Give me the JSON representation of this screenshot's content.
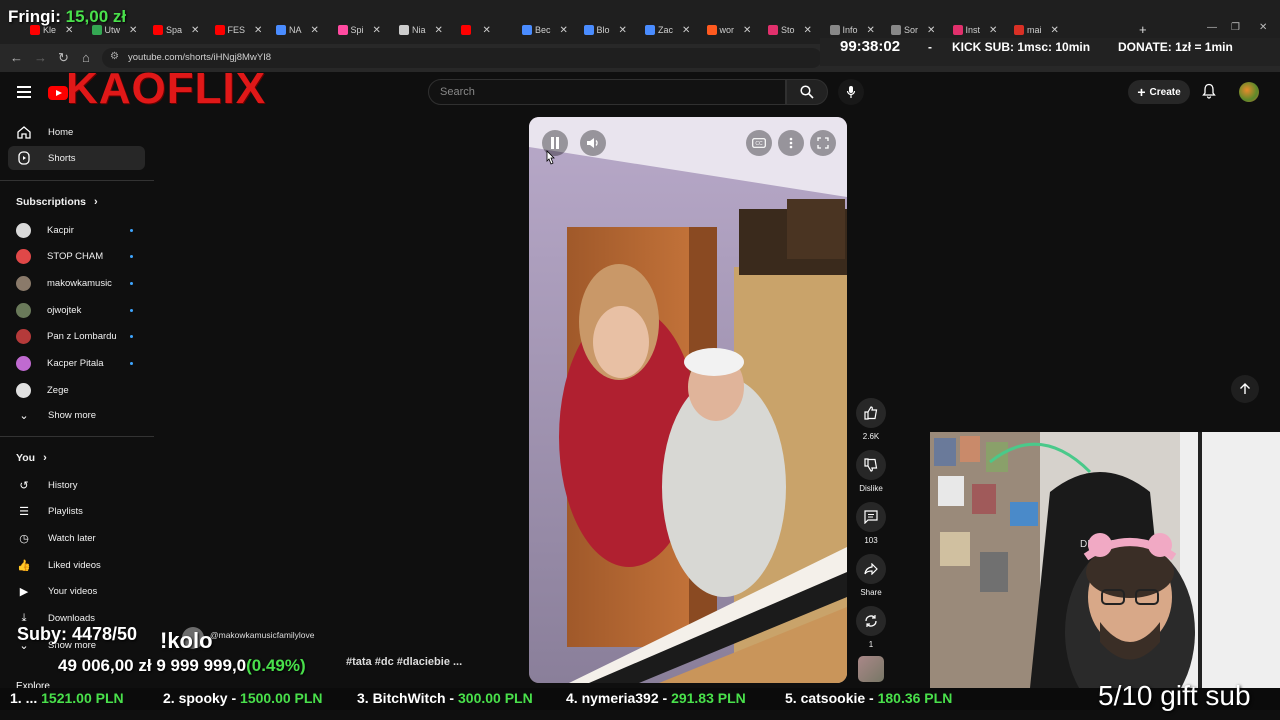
{
  "overlay": {
    "fringi_label": "Fringi: ",
    "fringi_amount": "15,00 zł",
    "timer": "99:38:02",
    "timer_sep": "-",
    "kick_sub": "KICK SUB: 1msc: 10min",
    "donate": "DONATE: 1zł = 1min",
    "suby": "Suby: 4478/50",
    "command": "!kolo",
    "channel_handle": "@makowkamusicfamilylove",
    "goal_amount": "49 006,00 zł",
    "goal_target": "9 999 999,0",
    "goal_pct": "(0.49%)",
    "hashtags": "#tata #dc #dlaciebie ...",
    "gift_sub": "5/10 gift sub",
    "ticker": [
      {
        "rank": "1. ...",
        "amount": "1521.00 PLN"
      },
      {
        "rank": "2. spooky -",
        "amount": "1500.00 PLN"
      },
      {
        "rank": "3. BitchWitch -",
        "amount": "300.00 PLN"
      },
      {
        "rank": "4. nymeria392 -",
        "amount": "291.83 PLN"
      },
      {
        "rank": "5. catsookie -",
        "amount": "180.36 PLN"
      }
    ]
  },
  "browser": {
    "url": "youtube.com/shorts/iHNgj8MwYI8",
    "tabs": [
      {
        "label": "Kle",
        "color": "#ff0000"
      },
      {
        "label": "Utw",
        "color": "#34a853"
      },
      {
        "label": "Spa",
        "color": "#ff0000"
      },
      {
        "label": "FES",
        "color": "#ff0000"
      },
      {
        "label": "NA",
        "color": "#4a8cff"
      },
      {
        "label": "Spi",
        "color": "#ff4aa0"
      },
      {
        "label": "Nia",
        "color": "#cccccc"
      },
      {
        "label": "",
        "color": "#ff0000"
      },
      {
        "label": "Bec",
        "color": "#4a8cff"
      },
      {
        "label": "Blo",
        "color": "#4a8cff"
      },
      {
        "label": "Zac",
        "color": "#4a8cff"
      },
      {
        "label": "wor",
        "color": "#ff5a1f"
      },
      {
        "label": "Sto",
        "color": "#e1306c"
      },
      {
        "label": "Info",
        "color": "#888888"
      },
      {
        "label": "Sor",
        "color": "#888888"
      },
      {
        "label": "Inst",
        "color": "#e1306c"
      },
      {
        "label": "mai",
        "color": "#d93025"
      }
    ]
  },
  "header": {
    "brand": "KAOFLIX",
    "search_placeholder": "Search",
    "create_label": "Create"
  },
  "sidebar": {
    "main": [
      {
        "label": "Home",
        "icon": "home-icon"
      },
      {
        "label": "Shorts",
        "icon": "shorts-icon"
      }
    ],
    "subscriptions_title": "Subscriptions",
    "subscriptions": [
      {
        "label": "Kacpir",
        "color": "#d9d9d9"
      },
      {
        "label": "STOP CHAM",
        "color": "#e04848"
      },
      {
        "label": "makowkamusic",
        "color": "#8a7a6a"
      },
      {
        "label": "ojwojtek",
        "color": "#6a7a5a"
      },
      {
        "label": "Pan z Lombardu",
        "color": "#b53a3a"
      },
      {
        "label": "Kacper Pitala",
        "color": "#c06ad0"
      },
      {
        "label": "Zege",
        "color": "#e0e0e0"
      }
    ],
    "show_more": "Show more",
    "you_title": "You",
    "you": [
      {
        "label": "History",
        "icon": "history-icon"
      },
      {
        "label": "Playlists",
        "icon": "playlists-icon"
      },
      {
        "label": "Watch later",
        "icon": "watch-later-icon"
      },
      {
        "label": "Liked videos",
        "icon": "liked-videos-icon"
      },
      {
        "label": "Your videos",
        "icon": "your-videos-icon"
      },
      {
        "label": "Downloads",
        "icon": "downloads-icon"
      }
    ],
    "show_more_2": "Show more",
    "explore": "Explore"
  },
  "actions": {
    "likes": "2.6K",
    "dislike": "Dislike",
    "comments": "103",
    "share": "Share",
    "remix": "1"
  }
}
